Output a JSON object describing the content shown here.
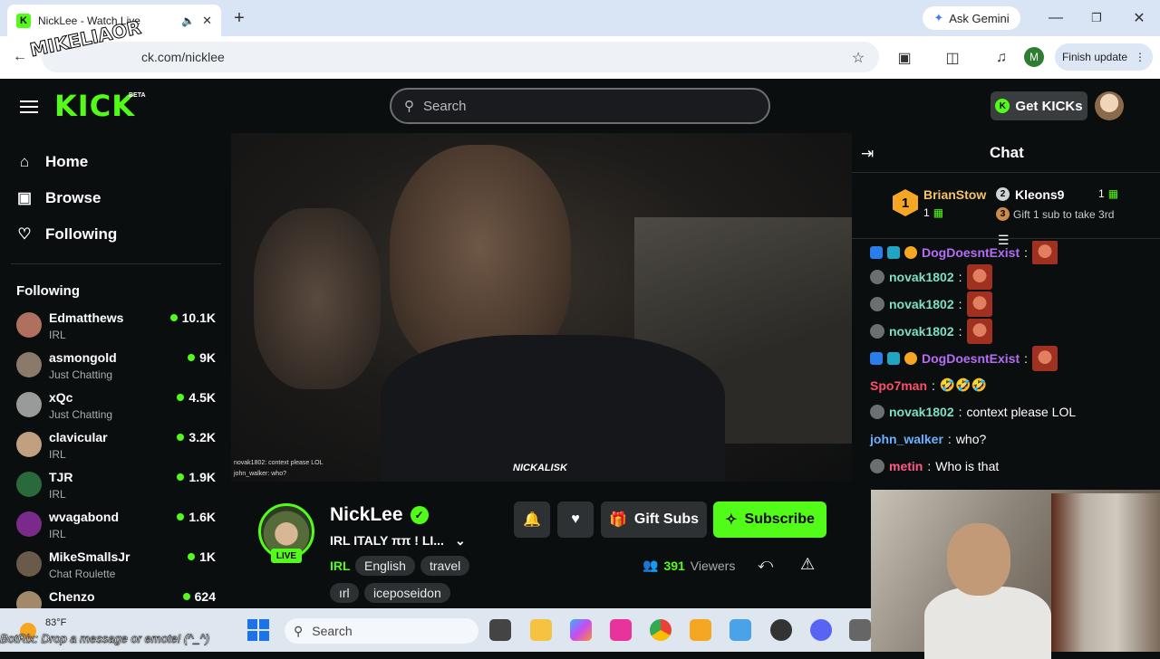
{
  "browser": {
    "tab_title": "NickLee - Watch Live",
    "url": "ck.com/nicklee",
    "ask_gemini": "Ask Gemini",
    "finish_update": "Finish update",
    "profile_letter": "M"
  },
  "overlay": {
    "watermark": "MIKELIAOR",
    "botrix": "BotRix: Drop a message or emote! (^_^)"
  },
  "header": {
    "logo": "KICK",
    "beta": "BETA",
    "search_placeholder": "Search",
    "get_kicks": "Get KICKs"
  },
  "sidebar": {
    "nav": [
      {
        "label": "Home",
        "icon": "home-icon"
      },
      {
        "label": "Browse",
        "icon": "browse-icon"
      },
      {
        "label": "Following",
        "icon": "heart-icon"
      }
    ],
    "following_heading": "Following",
    "channels": [
      {
        "name": "Edmatthews",
        "category": "IRL",
        "viewers": "10.1K",
        "color": "#b07060"
      },
      {
        "name": "asmongold",
        "category": "Just Chatting",
        "viewers": "9K",
        "color": "#8a7a6a"
      },
      {
        "name": "xQc",
        "category": "Just Chatting",
        "viewers": "4.5K",
        "color": "#9a9a9a"
      },
      {
        "name": "clavicular",
        "category": "IRL",
        "viewers": "3.2K",
        "color": "#c0a080"
      },
      {
        "name": "TJR",
        "category": "IRL",
        "viewers": "1.9K",
        "color": "#2a6a3a"
      },
      {
        "name": "wvagabond",
        "category": "IRL",
        "viewers": "1.6K",
        "color": "#7a2a8a"
      },
      {
        "name": "MikeSmallsJr",
        "category": "Chat Roulette",
        "viewers": "1K",
        "color": "#6a5a4a"
      },
      {
        "name": "Chenzo",
        "category": "",
        "viewers": "624",
        "color": "#a08a6a"
      }
    ]
  },
  "video": {
    "overlay_chat_1": "novak1802: context please LOL",
    "overlay_chat_2": "john_walker: who?",
    "brand": "NICKALISK"
  },
  "stream": {
    "name": "NickLee",
    "live": "LIVE",
    "title": "IRL ITALY ππ ! LI...",
    "category": "IRL",
    "tags": [
      "English",
      "travel",
      "ırl",
      "iceposeidon"
    ],
    "gift_subs": "Gift Subs",
    "subscribe": "Subscribe",
    "viewer_count": "391",
    "viewers_label": "Viewers"
  },
  "chat": {
    "title": "Chat",
    "leaderboard": {
      "first_name": "BrianStow",
      "first_count": "1",
      "second_name": "Kleons9",
      "second_count": "1",
      "third_text": "Gift 1 sub to take 3rd",
      "rank1": "1",
      "rank2": "2",
      "rank3": "3"
    },
    "messages": [
      {
        "user": "DogDoesntExist",
        "color": "#b56cf5",
        "text": "",
        "emote": true,
        "badges": true
      },
      {
        "user": "novak1802",
        "color": "#7ee0c0",
        "text": "",
        "emote": true
      },
      {
        "user": "novak1802",
        "color": "#7ee0c0",
        "text": "",
        "emote": true
      },
      {
        "user": "novak1802",
        "color": "#7ee0c0",
        "text": "",
        "emote": true
      },
      {
        "user": "DogDoesntExist",
        "color": "#b56cf5",
        "text": "",
        "emote": true,
        "badges": true
      },
      {
        "user": "Spo7man",
        "color": "#ff4d6a",
        "text": "🤣🤣🤣"
      },
      {
        "user": "novak1802",
        "color": "#7ee0c0",
        "text": "context please LOL"
      },
      {
        "user": "john_walker",
        "color": "#6ab0ff",
        "text": "who?"
      },
      {
        "user": "metin",
        "color": "#ff5a8a",
        "text": "Who is that"
      }
    ]
  },
  "taskbar": {
    "temperature": "83°F",
    "search": "Search"
  }
}
